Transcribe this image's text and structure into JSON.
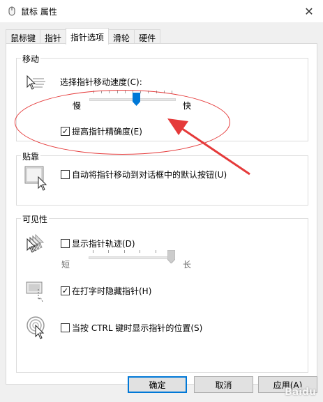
{
  "window": {
    "title": "鼠标 属性",
    "close_glyph": "✕"
  },
  "tabs": [
    {
      "label": "鼠标键"
    },
    {
      "label": "指针"
    },
    {
      "label": "指针选项",
      "active": true
    },
    {
      "label": "滑轮"
    },
    {
      "label": "硬件"
    }
  ],
  "motion": {
    "group_title": "移动",
    "speed_label": "选择指针移动速度(C):",
    "slow_label": "慢",
    "fast_label": "快",
    "speed_level": 0.55,
    "precision_label": "提高指针精确度(E)",
    "precision_checked": true
  },
  "snap": {
    "group_title": "贴靠",
    "label": "自动将指针移动到对话框中的默认按钮(U)",
    "checked": false
  },
  "visibility": {
    "group_title": "可见性",
    "trails_label": "显示指针轨迹(D)",
    "trails_checked": false,
    "short_label": "短",
    "long_label": "长",
    "trail_level": 1.0,
    "hide_label": "在打字时隐藏指针(H)",
    "hide_checked": true,
    "ctrl_label": "当按 CTRL 键时显示指针的位置(S)",
    "ctrl_checked": false
  },
  "buttons": {
    "ok": "确定",
    "cancel": "取消",
    "apply": "应用(A)"
  },
  "check_glyph": "✓",
  "accent_color": "#0078d7",
  "annotation_color": "#e53a3a",
  "watermark": "Baidu"
}
